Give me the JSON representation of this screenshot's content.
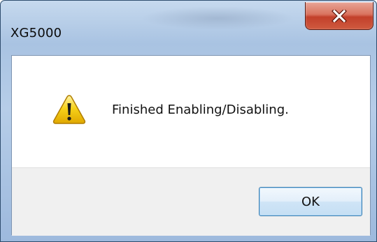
{
  "window": {
    "title": "XG5000"
  },
  "dialog": {
    "message": "Finished Enabling/Disabling.",
    "icon": "warning-icon",
    "ok_label": "OK"
  },
  "colors": {
    "close_button": "#c7452f",
    "ok_button_border": "#3c7fb1",
    "button_area_bg": "#f0f0f0",
    "warning_yellow": "#f7d21a"
  }
}
